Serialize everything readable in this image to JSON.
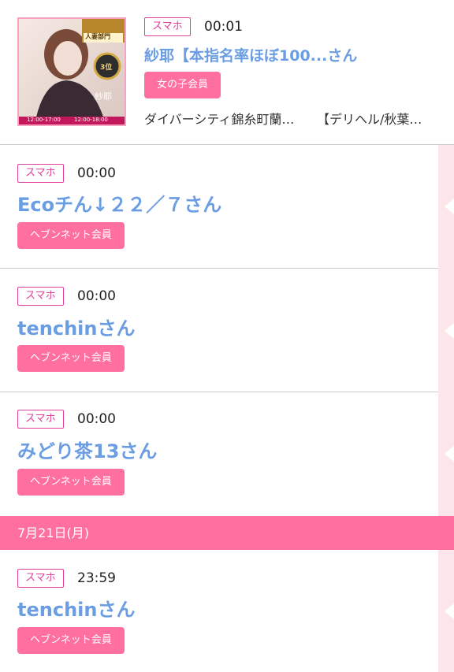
{
  "entries": [
    {
      "tag": "スマホ",
      "time": "00:01",
      "name": "紗耶【本指名率ほぼ100...さん",
      "badge": "女の子会員",
      "detail_left": "ダイバーシティ錦糸町蘭…",
      "detail_right": "【デリヘル/秋葉…",
      "thumb_labels": {
        "ribbon": "人妻部門",
        "rank": "3位",
        "caption": "紗耶",
        "hours_left": "12:00-17:00",
        "hours_right": "12:00-18:00"
      }
    },
    {
      "tag": "スマホ",
      "time": "00:00",
      "name": "Ecoチん↓２２／７さん",
      "badge": "ヘブンネット会員"
    },
    {
      "tag": "スマホ",
      "time": "00:00",
      "name": "tenchinさん",
      "badge": "ヘブンネット会員"
    },
    {
      "tag": "スマホ",
      "time": "00:00",
      "name": "みどり茶13さん",
      "badge": "ヘブンネット会員"
    },
    {
      "tag": "スマホ",
      "time": "23:59",
      "name": "tenchinさん",
      "badge": "ヘブンネット会員"
    }
  ],
  "date_header": "7月21日(月)",
  "colors": {
    "accent_pink": "#ff6fa0",
    "tag_magenta": "#e0409a",
    "name_blue": "#6b9de3",
    "rail_pink": "#fde6ea"
  }
}
